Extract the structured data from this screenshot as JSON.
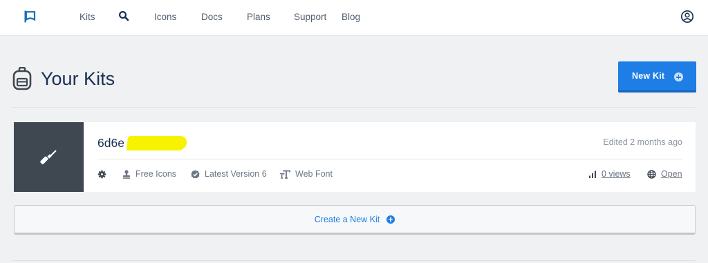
{
  "nav": {
    "logo_icon": "flag-icon",
    "items": [
      {
        "label": "Kits"
      },
      {
        "icon": "search-icon"
      },
      {
        "label": "Icons"
      },
      {
        "label": "Docs"
      },
      {
        "label": "Plans"
      },
      {
        "label": "Support"
      },
      {
        "label": "Blog"
      }
    ],
    "user_icon": "user-circle-icon"
  },
  "header": {
    "icon": "backpack-icon",
    "title": "Your Kits",
    "new_kit_label": "New Kit",
    "new_kit_icon": "plus-circle-icon"
  },
  "kit": {
    "name": "6d6e",
    "name_redacted": true,
    "edited": "Edited 2 months ago",
    "thumbnail_icon": "screwdriver-icon",
    "meta": {
      "settings_icon": "gear-icon",
      "license": "Free Icons",
      "version": "Latest Version 6",
      "tech": "Web Font",
      "views": "0 views",
      "open": "Open"
    }
  },
  "create": {
    "label": "Create a New Kit",
    "icon": "plus-circle-icon"
  },
  "colors": {
    "accent": "#1e7ee6",
    "text": "#183153",
    "muted": "#8d96a2",
    "thumb_bg": "#3f4751",
    "redaction": "#f7f200"
  }
}
